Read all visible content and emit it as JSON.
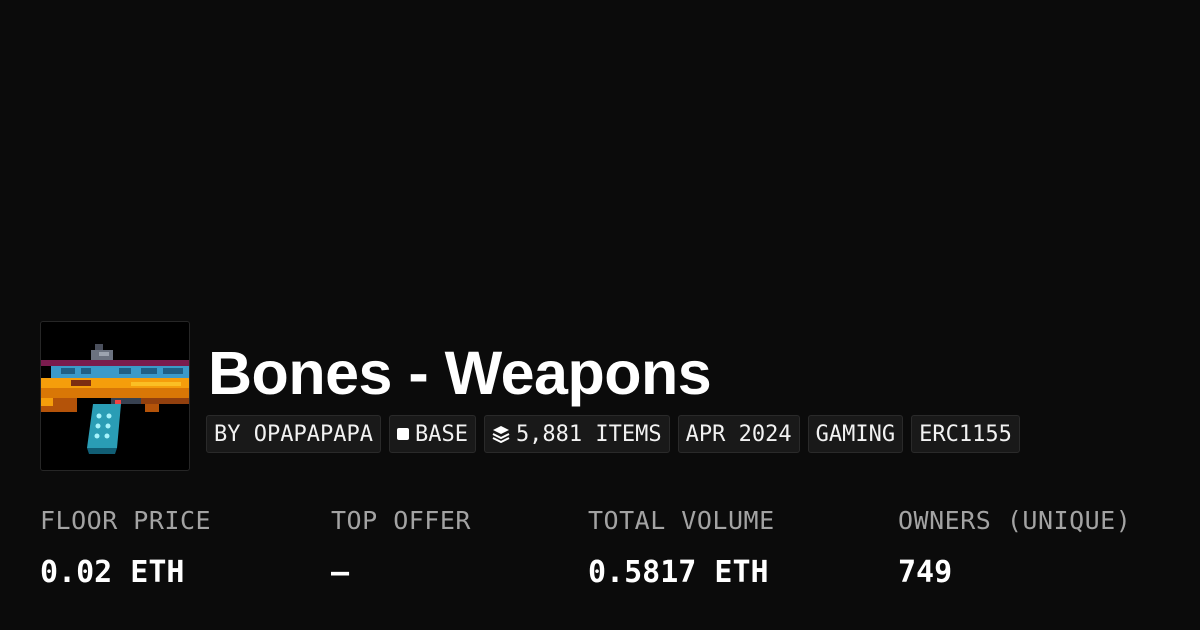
{
  "collection": {
    "title": "Bones - Weapons",
    "thumbnail_icon": "pixel-gun-icon"
  },
  "tags": {
    "creator": "BY OPAPAPAPA",
    "chain": "BASE",
    "chain_icon": "square-icon",
    "items": "5,881 ITEMS",
    "items_icon": "layers-icon",
    "date": "APR 2024",
    "category": "GAMING",
    "standard": "ERC1155"
  },
  "stats": {
    "floor_price": {
      "label": "FLOOR PRICE",
      "value": "0.02 ETH"
    },
    "top_offer": {
      "label": "TOP OFFER",
      "value": "—"
    },
    "total_volume": {
      "label": "TOTAL VOLUME",
      "value": "0.5817 ETH"
    },
    "owners": {
      "label": "OWNERS (UNIQUE)",
      "value": "749"
    }
  },
  "colors": {
    "background": "#0b0b0b",
    "tag_background": "#191919",
    "label_gray": "#a3a3a3",
    "text": "#ffffff"
  }
}
